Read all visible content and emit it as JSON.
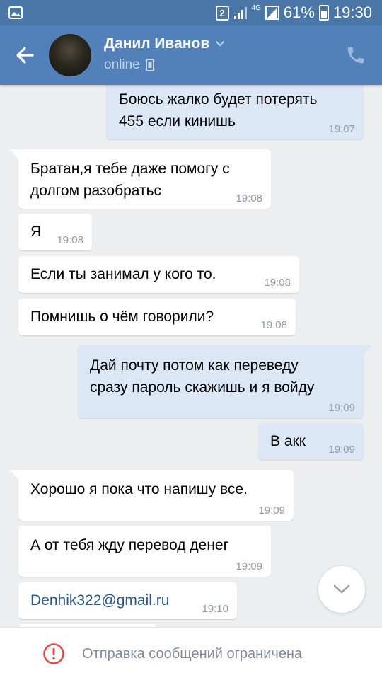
{
  "statusbar": {
    "sim_badge": "2",
    "network": "4G",
    "battery": "61%",
    "time": "19:30"
  },
  "header": {
    "name": "Данил Иванов",
    "status": "online"
  },
  "messages": [
    {
      "dir": "out",
      "text_lines": [
        "Боюсь жалко будет потерять",
        "455 если кинишь"
      ],
      "time": "19:07"
    },
    {
      "dir": "in",
      "text_lines": [
        "Братан,я тебе даже помогу с",
        "долгом разобратьс"
      ],
      "time": "19:08"
    },
    {
      "dir": "in",
      "text_lines": [
        "Я"
      ],
      "time": "19:08"
    },
    {
      "dir": "in",
      "text_lines": [
        "Если ты занимал у кого то."
      ],
      "time": "19:08"
    },
    {
      "dir": "in",
      "text_lines": [
        "Помнишь о чём говорили?"
      ],
      "time": "19:08"
    },
    {
      "dir": "out",
      "text_lines": [
        "Дай почту потом как переведу",
        "сразу пароль скажишь и я войду"
      ],
      "time": "19:09"
    },
    {
      "dir": "out",
      "text_lines": [
        "В акк"
      ],
      "time": "19:09"
    },
    {
      "dir": "in",
      "text_lines": [
        "Хорошо я пока что напишу все."
      ],
      "time": "19:09"
    },
    {
      "dir": "in",
      "text_lines": [
        "А от тебя жду перевод денег"
      ],
      "time": "19:09"
    },
    {
      "dir": "in",
      "text_lines": [
        "Denhik322@gmail.ru"
      ],
      "time": "19:10"
    }
  ],
  "bottom_bar": {
    "notice": "Отправка сообщений ограничена",
    "icon": "error-circle-icon"
  },
  "colors": {
    "accent": "#5181b8",
    "incoming_bubble": "#ffffff",
    "outgoing_bubble": "#dbe7f5",
    "error": "#e64646",
    "link": "#2a5885"
  }
}
